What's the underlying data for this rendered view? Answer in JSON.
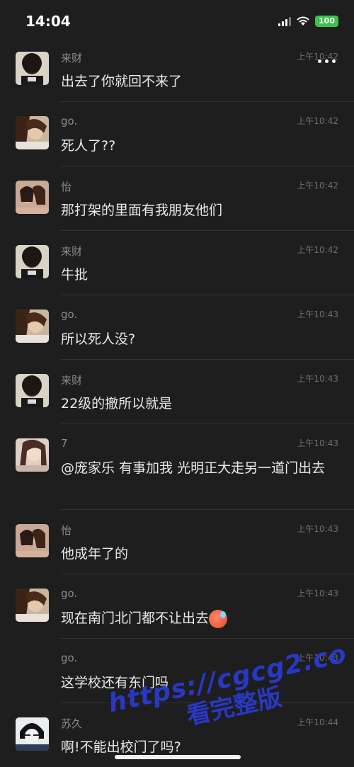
{
  "status": {
    "time": "14:04",
    "battery": "100"
  },
  "messages": [
    {
      "name": "来财",
      "time": "上午10:42",
      "text": "出去了你就回不来了",
      "avatar": "avatar-laicai"
    },
    {
      "name": "go.",
      "time": "上午10:42",
      "text": "死人了??",
      "avatar": "avatar-go"
    },
    {
      "name": "怡",
      "time": "上午10:42",
      "text": "那打架的里面有我朋友他们",
      "avatar": "avatar-yi"
    },
    {
      "name": "来财",
      "time": "上午10:42",
      "text": "牛批",
      "avatar": "avatar-laicai"
    },
    {
      "name": "go.",
      "time": "上午10:43",
      "text": "所以死人没?",
      "avatar": "avatar-go"
    },
    {
      "name": "来财",
      "time": "上午10:43",
      "text": "22级的撤所以就是",
      "avatar": "avatar-laicai"
    },
    {
      "name": "7",
      "time": "上午10:43",
      "text": "@庞家乐 有事加我 光明正大走另一道门出去",
      "avatar": "avatar-7"
    },
    {
      "name": "怡",
      "time": "上午10:43",
      "text": "他成年了的",
      "avatar": "avatar-yi"
    },
    {
      "name": "go.",
      "time": "上午10:43",
      "text": "现在南门北门都不让出去",
      "avatar": "avatar-go"
    },
    {
      "name": "go.",
      "time": "上午10:43",
      "text": "这学校还有东门吗",
      "avatar": "none"
    },
    {
      "name": "苏久",
      "time": "上午10:44",
      "text": "啊!不能出校门了吗?",
      "avatar": "avatar-sujiu"
    }
  ],
  "watermark": {
    "url": "https://cgcg2.co",
    "label": "看完整版"
  }
}
